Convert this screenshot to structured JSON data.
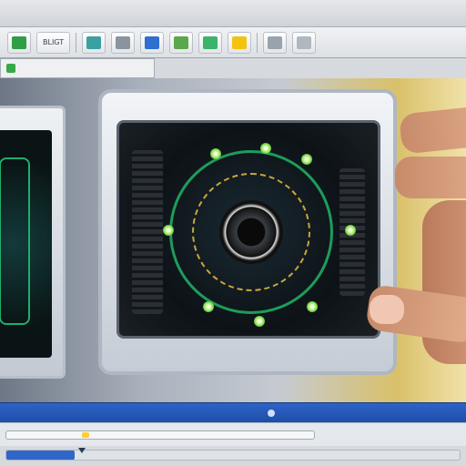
{
  "window": {
    "close_glyph": "+"
  },
  "toolbar": {
    "label_text": "BLIGT",
    "buttons": [
      {
        "icon": "map-icon",
        "color": "#2f9e44"
      },
      {
        "icon": "layers-icon",
        "color": "#3aa0a0"
      },
      {
        "icon": "cursor-icon",
        "color": "#8a949e"
      },
      {
        "icon": "square-icon",
        "color": "#2e6fd0"
      },
      {
        "icon": "chart-icon",
        "color": "#5aa84a"
      },
      {
        "icon": "leaf-icon",
        "color": "#3bb36a"
      },
      {
        "icon": "hazard-icon",
        "color": "#f2c40f"
      },
      {
        "icon": "shape-icon",
        "color": "#9aa3ad"
      },
      {
        "icon": "doc-icon",
        "color": "#b0b7bf"
      }
    ]
  },
  "subbar": {
    "label": ""
  },
  "scroll": {
    "position": 0.25
  },
  "progress": {
    "value": 0.15
  }
}
